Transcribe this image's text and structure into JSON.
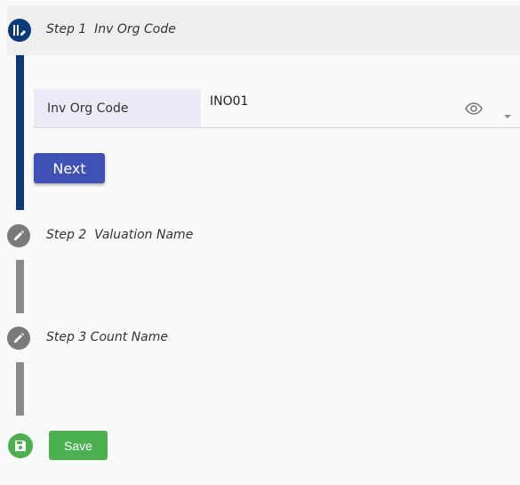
{
  "steps": [
    {
      "title": "Step 1  Inv Org Code"
    },
    {
      "title": "Step 2  Valuation Name"
    },
    {
      "title": "Step 3 Count Name"
    }
  ],
  "field": {
    "label": "Inv Org Code",
    "value": "INO01"
  },
  "buttons": {
    "next": "Next",
    "save": "Save"
  },
  "colors": {
    "active": "#0b3a78",
    "inactive": "#7a7a7a",
    "next": "#3f51b5",
    "save": "#4caf50",
    "label_bg": "#ede9f6"
  },
  "icons": {
    "step1": "edit-stepper-icon",
    "step2": "pencil-icon",
    "step3": "pencil-icon",
    "save": "floppy-disk-icon",
    "field_view": "eye-icon",
    "field_dropdown": "caret-down-icon"
  }
}
